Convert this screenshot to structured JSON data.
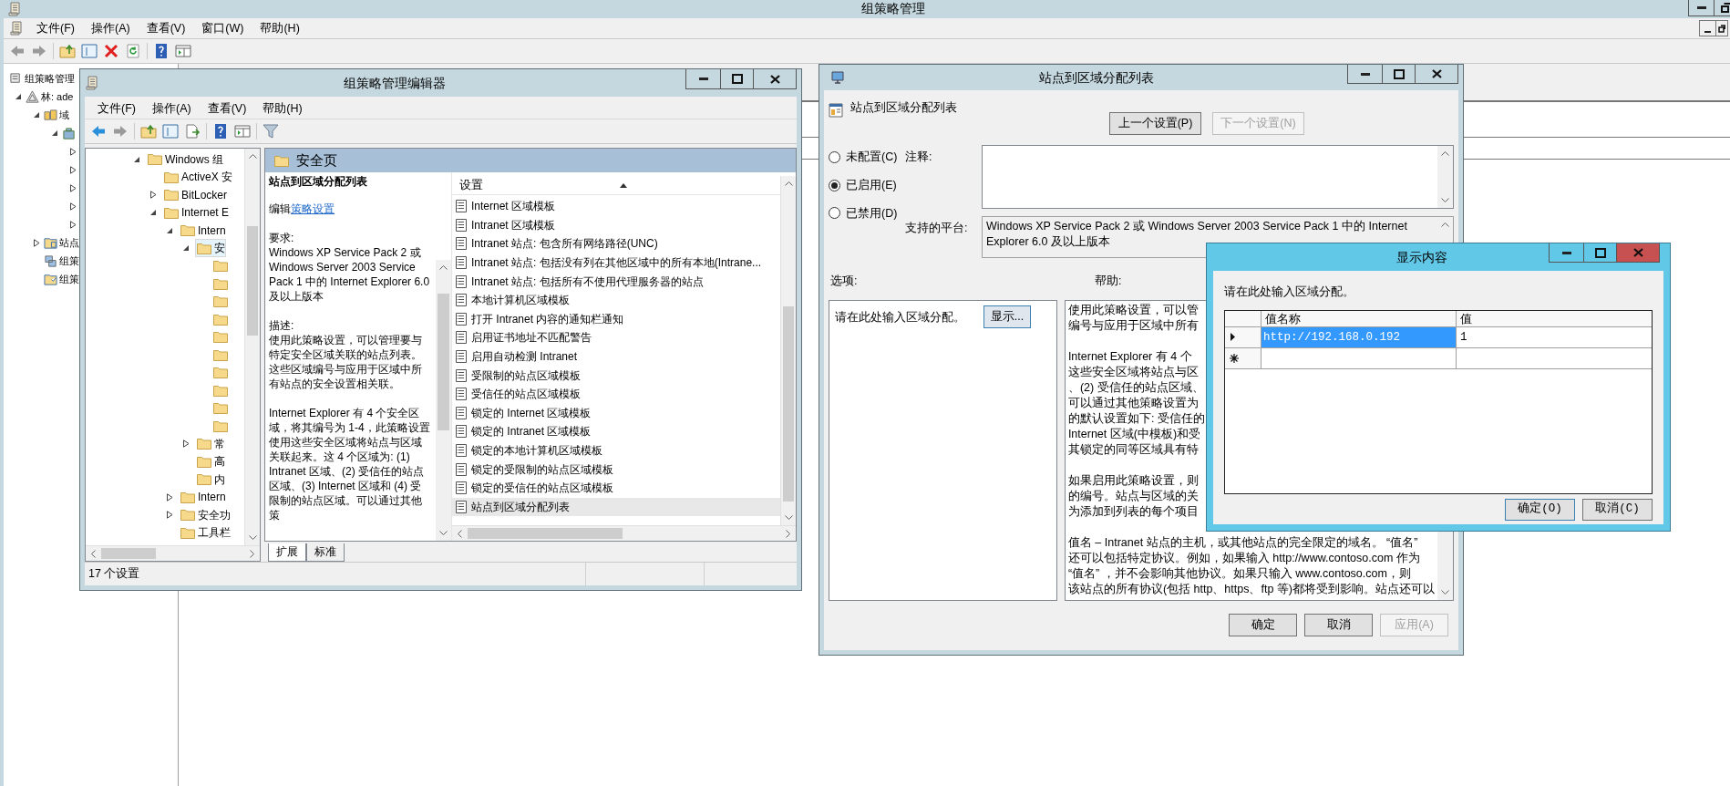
{
  "main_window": {
    "title": "组策略管理",
    "menu": [
      "文件(F)",
      "操作(A)",
      "查看(V)",
      "窗口(W)",
      "帮助(H)"
    ],
    "tree": [
      {
        "label": "组策略管理",
        "kind": "console",
        "selected": false,
        "children": [
          {
            "label": "林: ade",
            "kind": "forest",
            "expanded": true,
            "selected": false,
            "children": [
              {
                "label": "域",
                "kind": "domain",
                "expanded": true,
                "selected": false,
                "children": [
                  {
                    "kind": "ou",
                    "expanded": true,
                    "selected": false,
                    "children": [
                      {
                        "expanded": false
                      },
                      {
                        "expanded": false
                      },
                      {
                        "expanded": false
                      },
                      {
                        "expanded": false
                      },
                      {
                        "expanded": false
                      }
                    ]
                  }
                ]
              },
              {
                "label": "站点",
                "kind": "site",
                "expanded": false,
                "selected": false
              },
              {
                "label": "组策",
                "kind": "gpo",
                "selected": false
              },
              {
                "label": "组策",
                "kind": "results",
                "selected": false
              }
            ]
          }
        ]
      }
    ]
  },
  "editor": {
    "title": "组策略管理编辑器",
    "menu": [
      "文件(F)",
      "操作(A)",
      "查看(V)",
      "帮助(H)"
    ],
    "tree": [
      {
        "label": "Windows 组",
        "expanded": true,
        "selected": false,
        "children": [
          {
            "label": "ActiveX 安",
            "selected": false
          },
          {
            "label": "BitLocker",
            "expanded": false,
            "selected": false
          },
          {
            "label": "Internet E",
            "expanded": true,
            "selected": false,
            "children": [
              {
                "label": "Intern",
                "expanded": true,
                "selected": false,
                "children": [
                  {
                    "label": "安",
                    "expanded": true,
                    "selected": true,
                    "children": [
                      {
                        "selected": false
                      },
                      {
                        "selected": false
                      },
                      {
                        "selected": false
                      },
                      {
                        "selected": false
                      },
                      {
                        "selected": false
                      },
                      {
                        "selected": false
                      },
                      {
                        "selected": false
                      },
                      {
                        "selected": false
                      },
                      {
                        "selected": false
                      },
                      {
                        "selected": false
                      }
                    ]
                  },
                  {
                    "label": "常",
                    "expanded": false,
                    "selected": false
                  },
                  {
                    "label": "高",
                    "selected": false
                  },
                  {
                    "label": "内",
                    "selected": false
                  }
                ]
              },
              {
                "label": "Intern",
                "expanded": false,
                "selected": false
              },
              {
                "label": "安全功",
                "expanded": false,
                "selected": false
              },
              {
                "label": "工具栏",
                "selected": false
              }
            ]
          }
        ]
      }
    ],
    "section": "安全页",
    "description": {
      "title": "站点到区域分配列表",
      "edit_prefix": "编辑",
      "edit_link": "策略设置",
      "requirements_label": "要求:",
      "requirements": "Windows XP Service Pack 2 或 Windows Server 2003 Service Pack 1 中的 Internet Explorer 6.0 及以上版本",
      "description_label": "描述:",
      "paragraphs": [
        "使用此策略设置，可以管理要与特定安全区域关联的站点列表。这些区域编号与应用于区域中所有站点的安全设置相关联。",
        "Internet Explorer 有 4 个安全区域，将其编号为 1-4，此策略设置使用这些安全区域将站点与区域关联起来。这 4 个区域为: (1) Intranet 区域、(2) 受信任的站点区域、(3) Internet 区域和 (4) 受限制的站点区域。可以通过其他策"
      ]
    },
    "list_column": "设置",
    "settings": [
      {
        "label": "Internet 区域模板",
        "selected": false
      },
      {
        "label": "Intranet 区域模板",
        "selected": false
      },
      {
        "label": "Intranet 站点: 包含所有网络路径(UNC)",
        "selected": false
      },
      {
        "label": "Intranet 站点: 包括没有列在其他区域中的所有本地(Intrane...",
        "selected": false
      },
      {
        "label": "Intranet 站点: 包括所有不使用代理服务器的站点",
        "selected": false
      },
      {
        "label": "本地计算机区域模板",
        "selected": false
      },
      {
        "label": "打开 Intranet 内容的通知栏通知",
        "selected": false
      },
      {
        "label": "启用证书地址不匹配警告",
        "selected": false
      },
      {
        "label": "启用自动检测 Intranet",
        "selected": false
      },
      {
        "label": "受限制的站点区域模板",
        "selected": false
      },
      {
        "label": "受信任的站点区域模板",
        "selected": false
      },
      {
        "label": "锁定的 Internet 区域模板",
        "selected": false
      },
      {
        "label": "锁定的 Intranet 区域模板",
        "selected": false
      },
      {
        "label": "锁定的本地计算机区域模板",
        "selected": false
      },
      {
        "label": "锁定的受限制的站点区域模板",
        "selected": false
      },
      {
        "label": "锁定的受信任的站点区域模板",
        "selected": false
      },
      {
        "label": "站点到区域分配列表",
        "selected": true
      }
    ],
    "tabs": [
      {
        "label": "扩展",
        "selected": true
      },
      {
        "label": "标准",
        "selected": false
      }
    ],
    "status": "17 个设置"
  },
  "dialog": {
    "title": "站点到区域分配列表",
    "heading": "站点到区域分配列表",
    "nav_buttons": [
      {
        "label": "上一个设置(P)",
        "disabled": false
      },
      {
        "label": "下一个设置(N)",
        "disabled": true
      }
    ],
    "options": [
      {
        "label": "未配置(C)",
        "selected": false
      },
      {
        "label": "已启用(E)",
        "selected": true
      },
      {
        "label": "已禁用(D)",
        "selected": false
      }
    ],
    "comment_label": "注释:",
    "platform_label": "支持的平台:",
    "platform": "Windows XP Service Pack 2 或 Windows Server 2003 Service Pack 1 中的 Internet Explorer 6.0 及以上版本",
    "options_label": "选项:",
    "help_label": "帮助:",
    "options_text": "请在此处输入区域分配。",
    "show_button": "显示...",
    "help": [
      {
        "lines": [
          "使用此策略设置，可以管",
          "编号与应用于区域中所有"
        ]
      },
      {
        "lines": [
          "Internet Explorer 有 4 个",
          "这些安全区域将站点与区",
          "、(2) 受信任的站点区域、",
          "可以通过其他策略设置为",
          "的默认设置如下: 受信任的",
          "Internet 区域(中模板)和受",
          "其锁定的同等区域具有特"
        ]
      },
      {
        "lines": [
          "如果启用此策略设置，则",
          "的编号。站点与区域的关",
          "为添加到列表的每个项目"
        ]
      },
      {
        "lines": [
          "值名 – Intranet 站点的主机，或其他站点的完全限定的域名。 “值名”",
          "还可以包括特定协议。例如，如果输入 http://www.contoso.com 作为",
          " “值名” ，并不会影响其他协议。如果只输入 www.contoso.com，则",
          "该站点的所有协议(包括 http、https、ftp 等)都将受到影响。站点还可以"
        ]
      }
    ],
    "buttons": [
      {
        "label": "确定",
        "disabled": false
      },
      {
        "label": "取消",
        "disabled": false
      },
      {
        "label": "应用(A)",
        "disabled": true
      }
    ]
  },
  "show_contents": {
    "title": "显示内容",
    "prompt": "请在此处输入区域分配。",
    "columns": [
      "值名称",
      "值"
    ],
    "rows": [
      {
        "name": "http://192.168.0.192",
        "value": "1",
        "selected": true
      }
    ],
    "buttons": [
      "确定(O)",
      "取消(C)"
    ]
  }
}
